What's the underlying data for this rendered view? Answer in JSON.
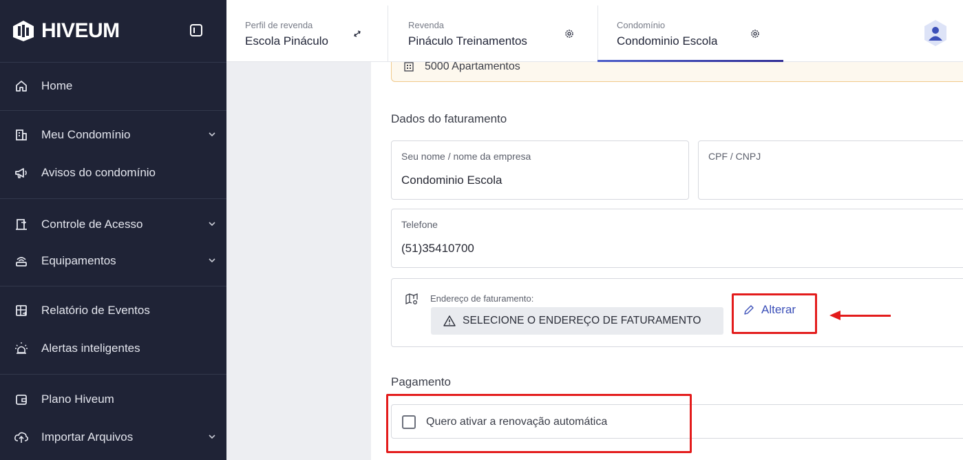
{
  "sidebar": {
    "brand": "HIVEUM",
    "items": [
      {
        "label": "Home",
        "icon": "home-icon"
      },
      {
        "label": "Meu Condomínio",
        "icon": "building-icon",
        "has_chevron": true
      },
      {
        "label": "Avisos do condomínio",
        "icon": "megaphone-icon"
      },
      {
        "label": "Controle de Acesso",
        "icon": "door-icon",
        "has_chevron": true
      },
      {
        "label": "Equipamentos",
        "icon": "router-icon",
        "has_chevron": true
      },
      {
        "label": "Relatório de Eventos",
        "icon": "report-icon"
      },
      {
        "label": "Alertas inteligentes",
        "icon": "alarm-light-icon"
      },
      {
        "label": "Plano Hiveum",
        "icon": "wallet-icon"
      },
      {
        "label": "Importar Arquivos",
        "icon": "cloud-upload-icon",
        "has_chevron": true
      }
    ]
  },
  "topbar": {
    "tabs": [
      {
        "caption": "Perfil de revenda",
        "value": "Escola Pináculo",
        "icon": "swap-icon"
      },
      {
        "caption": "Revenda",
        "value": "Pináculo Treinamentos",
        "icon": "gear-icon"
      },
      {
        "caption": "Condomínio",
        "value": "Condominio Escola",
        "icon": "gear-icon"
      }
    ],
    "active_tab": 2
  },
  "main": {
    "apartments": "5000 Apartamentos",
    "billing_title": "Dados do faturamento",
    "name_field": {
      "label": "Seu nome / nome da empresa",
      "value": "Condominio Escola"
    },
    "cpf_field": {
      "label": "CPF / CNPJ",
      "value": ""
    },
    "phone_field": {
      "label": "Telefone",
      "value": "(51)35410700"
    },
    "address": {
      "label": "Endereço de faturamento:",
      "placeholder": "SELECIONE O ENDEREÇO DE FATURAMENTO",
      "change_button": "Alterar"
    },
    "payment_title": "Pagamento",
    "auto_renew_label": "Quero ativar a renovação automática",
    "auto_renew_checked": false
  },
  "colors": {
    "sidebar_bg": "#1f2336",
    "accent": "#3b4fb8",
    "highlight": "#e31b1b",
    "warning_bg": "#fdf8ee"
  }
}
